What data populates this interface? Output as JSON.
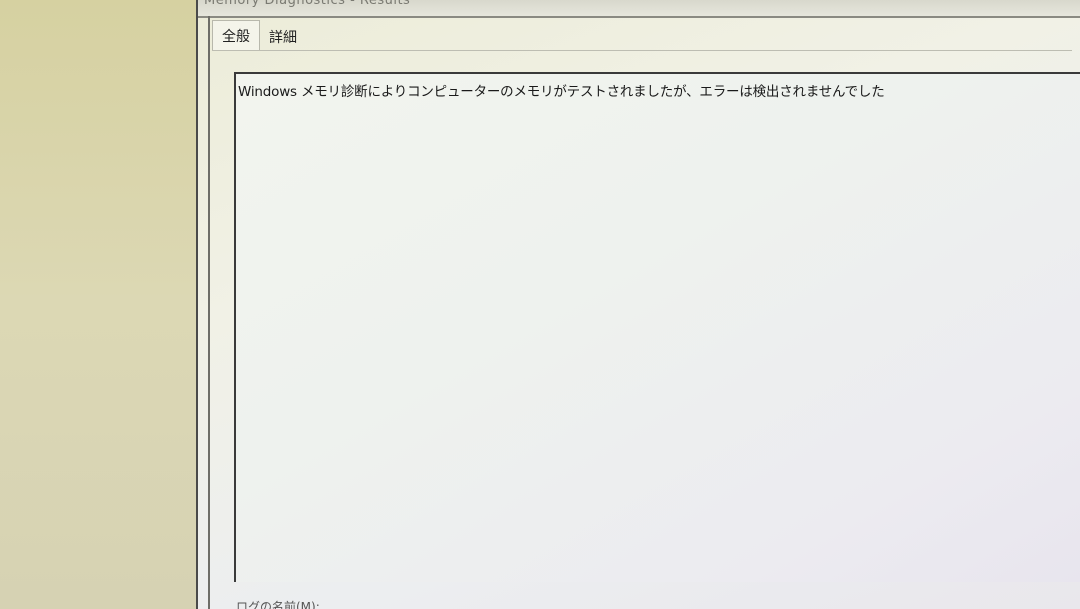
{
  "window": {
    "title": "Memory Diagnostics - Results"
  },
  "tabs": [
    {
      "label": "全般",
      "active": true
    },
    {
      "label": "詳細",
      "active": false
    }
  ],
  "general": {
    "message": "Windows メモリ診断によりコンピューターのメモリがテストされましたが、エラーは検出されませんでした"
  },
  "footer": {
    "log_name_label": "ログの名前(M):"
  }
}
